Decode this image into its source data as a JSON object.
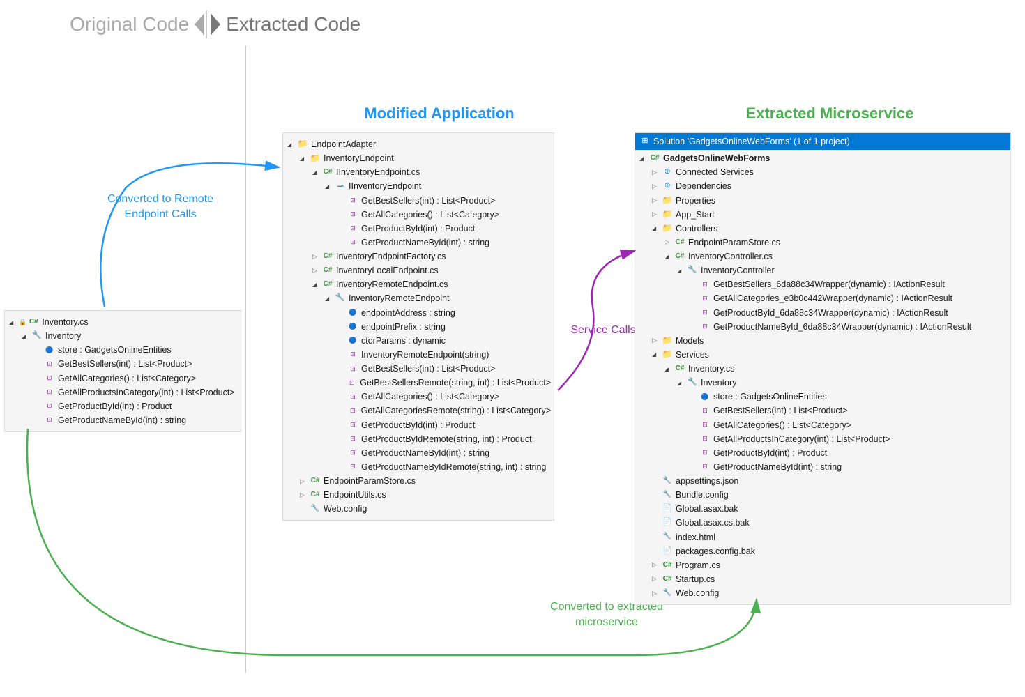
{
  "header": {
    "original": "Original Code",
    "extracted": "Extracted Code"
  },
  "titles": {
    "modified": "Modified Application",
    "extracted": "Extracted Microservice"
  },
  "labels": {
    "converted_remote": "Converted to Remote Endpoint Calls",
    "service_calls": "Service Calls",
    "converted_micro": "Converted to extracted microservice"
  },
  "original_tree": {
    "file": "Inventory.cs",
    "class": "Inventory",
    "members": [
      {
        "icon": "field",
        "text": "store : GadgetsOnlineEntities"
      },
      {
        "icon": "method",
        "text": "GetBestSellers(int) : List<Product>"
      },
      {
        "icon": "method",
        "text": "GetAllCategories() : List<Category>"
      },
      {
        "icon": "method",
        "text": "GetAllProductsInCategory(int) : List<Product>"
      },
      {
        "icon": "method",
        "text": "GetProductById(int) : Product"
      },
      {
        "icon": "method",
        "text": "GetProductNameById(int) : string"
      }
    ]
  },
  "modified_tree": {
    "root": "EndpointAdapter",
    "items": [
      {
        "indent": 1,
        "expand": "open",
        "icon": "folder",
        "text": "InventoryEndpoint"
      },
      {
        "indent": 2,
        "expand": "open",
        "icon": "cs",
        "text": "IInventoryEndpoint.cs"
      },
      {
        "indent": 3,
        "expand": "open",
        "icon": "interface",
        "text": "IInventoryEndpoint"
      },
      {
        "indent": 4,
        "expand": "none",
        "icon": "method",
        "text": "GetBestSellers(int) : List<Product>"
      },
      {
        "indent": 4,
        "expand": "none",
        "icon": "method",
        "text": "GetAllCategories() : List<Category>"
      },
      {
        "indent": 4,
        "expand": "none",
        "icon": "method",
        "text": "GetProductById(int) : Product"
      },
      {
        "indent": 4,
        "expand": "none",
        "icon": "method",
        "text": "GetProductNameById(int) : string"
      },
      {
        "indent": 2,
        "expand": "closed",
        "icon": "cs",
        "text": "InventoryEndpointFactory.cs"
      },
      {
        "indent": 2,
        "expand": "closed",
        "icon": "cs",
        "text": "InventoryLocalEndpoint.cs"
      },
      {
        "indent": 2,
        "expand": "open",
        "icon": "cs",
        "text": "InventoryRemoteEndpoint.cs"
      },
      {
        "indent": 3,
        "expand": "open",
        "icon": "class",
        "text": "InventoryRemoteEndpoint"
      },
      {
        "indent": 4,
        "expand": "none",
        "icon": "field",
        "text": "endpointAddress : string"
      },
      {
        "indent": 4,
        "expand": "none",
        "icon": "field",
        "text": "endpointPrefix : string"
      },
      {
        "indent": 4,
        "expand": "none",
        "icon": "field",
        "text": "ctorParams : dynamic"
      },
      {
        "indent": 4,
        "expand": "none",
        "icon": "method",
        "text": "InventoryRemoteEndpoint(string)"
      },
      {
        "indent": 4,
        "expand": "none",
        "icon": "method",
        "text": "GetBestSellers(int) : List<Product>"
      },
      {
        "indent": 4,
        "expand": "none",
        "icon": "method",
        "text": "GetBestSellersRemote(string, int) : List<Product>"
      },
      {
        "indent": 4,
        "expand": "none",
        "icon": "method",
        "text": "GetAllCategories() : List<Category>"
      },
      {
        "indent": 4,
        "expand": "none",
        "icon": "method",
        "text": "GetAllCategoriesRemote(string) : List<Category>"
      },
      {
        "indent": 4,
        "expand": "none",
        "icon": "method",
        "text": "GetProductById(int) : Product"
      },
      {
        "indent": 4,
        "expand": "none",
        "icon": "method",
        "text": "GetProductByIdRemote(string, int) : Product"
      },
      {
        "indent": 4,
        "expand": "none",
        "icon": "method",
        "text": "GetProductNameById(int) : string"
      },
      {
        "indent": 4,
        "expand": "none",
        "icon": "method",
        "text": "GetProductNameByIdRemote(string, int) : string"
      },
      {
        "indent": 1,
        "expand": "closed",
        "icon": "cs",
        "text": "EndpointParamStore.cs"
      },
      {
        "indent": 1,
        "expand": "closed",
        "icon": "cs",
        "text": "EndpointUtils.cs"
      },
      {
        "indent": 1,
        "expand": "none",
        "icon": "config",
        "text": "Web.config"
      }
    ]
  },
  "extracted_tree": {
    "solution": "Solution 'GadgetsOnlineWebForms' (1 of 1 project)",
    "project": "GadgetsOnlineWebForms",
    "items": [
      {
        "indent": 1,
        "expand": "closed",
        "icon": "ref",
        "text": "Connected Services"
      },
      {
        "indent": 1,
        "expand": "closed",
        "icon": "ref",
        "text": "Dependencies"
      },
      {
        "indent": 1,
        "expand": "closed",
        "icon": "folder",
        "text": "Properties"
      },
      {
        "indent": 1,
        "expand": "closed",
        "icon": "folder",
        "text": "App_Start"
      },
      {
        "indent": 1,
        "expand": "open",
        "icon": "folder",
        "text": "Controllers"
      },
      {
        "indent": 2,
        "expand": "closed",
        "icon": "cs",
        "text": "EndpointParamStore.cs"
      },
      {
        "indent": 2,
        "expand": "open",
        "icon": "cs",
        "text": "InventoryController.cs"
      },
      {
        "indent": 3,
        "expand": "open",
        "icon": "class",
        "text": "InventoryController"
      },
      {
        "indent": 4,
        "expand": "none",
        "icon": "method",
        "text": "GetBestSellers_6da88c34Wrapper(dynamic) : IActionResult"
      },
      {
        "indent": 4,
        "expand": "none",
        "icon": "method",
        "text": "GetAllCategories_e3b0c442Wrapper(dynamic) : IActionResult"
      },
      {
        "indent": 4,
        "expand": "none",
        "icon": "method",
        "text": "GetProductById_6da88c34Wrapper(dynamic) : IActionResult"
      },
      {
        "indent": 4,
        "expand": "none",
        "icon": "method",
        "text": "GetProductNameById_6da88c34Wrapper(dynamic) : IActionResult"
      },
      {
        "indent": 1,
        "expand": "closed",
        "icon": "folder",
        "text": "Models"
      },
      {
        "indent": 1,
        "expand": "open",
        "icon": "folder",
        "text": "Services"
      },
      {
        "indent": 2,
        "expand": "open",
        "icon": "cs",
        "text": "Inventory.cs"
      },
      {
        "indent": 3,
        "expand": "open",
        "icon": "class",
        "text": "Inventory"
      },
      {
        "indent": 4,
        "expand": "none",
        "icon": "field",
        "text": "store : GadgetsOnlineEntities"
      },
      {
        "indent": 4,
        "expand": "none",
        "icon": "method",
        "text": "GetBestSellers(int) : List<Product>"
      },
      {
        "indent": 4,
        "expand": "none",
        "icon": "method",
        "text": "GetAllCategories() : List<Category>"
      },
      {
        "indent": 4,
        "expand": "none",
        "icon": "method",
        "text": "GetAllProductsInCategory(int) : List<Product>"
      },
      {
        "indent": 4,
        "expand": "none",
        "icon": "method",
        "text": "GetProductById(int) : Product"
      },
      {
        "indent": 4,
        "expand": "none",
        "icon": "method",
        "text": "GetProductNameById(int) : string"
      },
      {
        "indent": 1,
        "expand": "none",
        "icon": "config",
        "text": "appsettings.json"
      },
      {
        "indent": 1,
        "expand": "none",
        "icon": "config",
        "text": "Bundle.config"
      },
      {
        "indent": 1,
        "expand": "none",
        "icon": "file",
        "text": "Global.asax.bak"
      },
      {
        "indent": 1,
        "expand": "none",
        "icon": "file",
        "text": "Global.asax.cs.bak"
      },
      {
        "indent": 1,
        "expand": "none",
        "icon": "config",
        "text": "index.html"
      },
      {
        "indent": 1,
        "expand": "none",
        "icon": "file",
        "text": "packages.config.bak"
      },
      {
        "indent": 1,
        "expand": "closed",
        "icon": "cs",
        "text": "Program.cs"
      },
      {
        "indent": 1,
        "expand": "closed",
        "icon": "cs",
        "text": "Startup.cs"
      },
      {
        "indent": 1,
        "expand": "closed",
        "icon": "config",
        "text": "Web.config"
      }
    ]
  }
}
